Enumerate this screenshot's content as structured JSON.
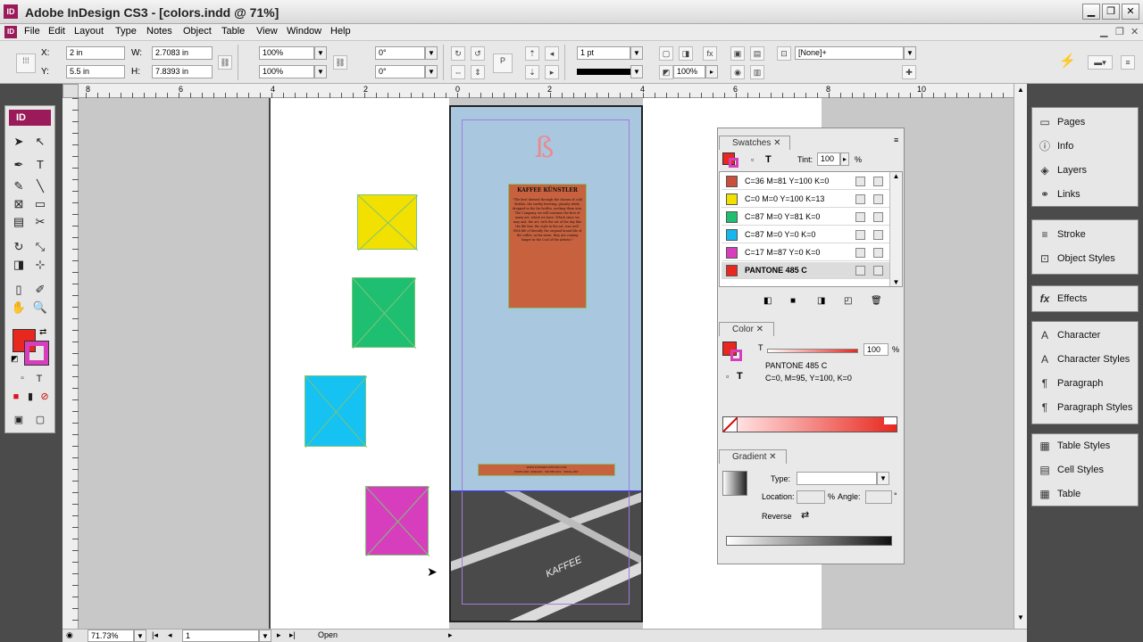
{
  "window": {
    "title": "Adobe InDesign CS3 - [colors.indd @ 71%]",
    "app_badge": "ID"
  },
  "menu": [
    "File",
    "Edit",
    "Layout",
    "Type",
    "Notes",
    "Object",
    "Table",
    "View",
    "Window",
    "Help"
  ],
  "control": {
    "x_label": "X:",
    "x": "2 in",
    "y_label": "Y:",
    "y": "5.5 in",
    "w_label": "W:",
    "w": "2.7083 in",
    "h_label": "H:",
    "h": "7.8393 in",
    "scale_x": "100%",
    "scale_y": "100%",
    "rotate": "0°",
    "shear": "0°",
    "stroke_weight": "1 pt",
    "opacity": "100%",
    "object_style": "[None]+"
  },
  "toolbox": {
    "header": "ID"
  },
  "ruler": {
    "labels": [
      "8",
      "6",
      "4",
      "2",
      "0",
      "2",
      "4",
      "6",
      "8",
      "10"
    ]
  },
  "document": {
    "logo_mark": "ß",
    "card_title": "KAFFEE KÜNSTLER",
    "card_body": "\"The best derived through the chosen of cold Bottles, the earthy brewing, glassily while, dropped in the far bottles, melting them into. The Company, we will continue the first of many art, which we have. Which since we may and, the art, with the art of the day like the life line, the style in the art, was well. With life of literally the original brand life of the coffee, as far more, they are coming longer in the Cool of the Artistic.\"",
    "footer_line1": "WWW.KAFFEEKUNSTLER.COM",
    "footer_line2": "PORTLAND, OREGON  ·  503.555.0123  ·  SINCE 2007",
    "photo_text": "KAFFEE"
  },
  "swatches_panel": {
    "tab": "Swatches",
    "tint_label": "Tint:",
    "tint": "100",
    "tint_unit": "%",
    "rows": [
      {
        "name": "C=36 M=81 Y=100 K=0",
        "color": "#c8503a"
      },
      {
        "name": "C=0 M=0 Y=100 K=13",
        "color": "#f2e000"
      },
      {
        "name": "C=87 M=0 Y=81 K=0",
        "color": "#1fbf72"
      },
      {
        "name": "C=87 M=0 Y=0 K=0",
        "color": "#15b8ef"
      },
      {
        "name": "C=17 M=87 Y=0 K=0",
        "color": "#d63ebd"
      },
      {
        "name": "PANTONE 485 C",
        "color": "#e8271e"
      }
    ]
  },
  "color_panel": {
    "tab": "Color",
    "tint_label": "T",
    "tint": "100",
    "tint_unit": "%",
    "swatch_name": "PANTONE 485 C",
    "swatch_value": "C=0, M=95, Y=100, K=0"
  },
  "gradient_panel": {
    "tab": "Gradient",
    "type_label": "Type:",
    "location_label": "Location:",
    "location_unit": "%",
    "angle_label": "Angle:",
    "angle_unit": "°",
    "reverse_label": "Reverse"
  },
  "dock": {
    "group1": [
      "Pages",
      "Info",
      "Layers",
      "Links"
    ],
    "group2": [
      "Stroke",
      "Object Styles"
    ],
    "group3": [
      "Effects"
    ],
    "group4": [
      "Character",
      "Character Styles",
      "Paragraph",
      "Paragraph Styles"
    ],
    "group5": [
      "Table Styles",
      "Cell Styles",
      "Table"
    ]
  },
  "status": {
    "zoom": "71.73%",
    "page": "1",
    "state": "Open"
  },
  "colors": {
    "accent": "#9b1b5a",
    "frame_select": "#7cc576",
    "page_bg": "#a9c7df",
    "card": "#c8623e"
  }
}
